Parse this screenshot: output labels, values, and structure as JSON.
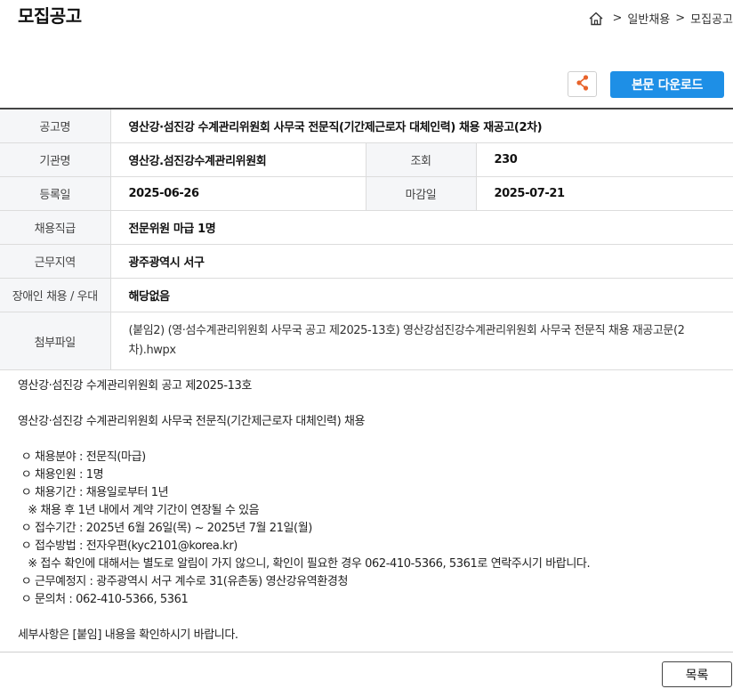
{
  "header": {
    "title": "모집공고",
    "breadcrumb": {
      "sep1": ">",
      "item1": "일반채용",
      "sep2": ">",
      "item2": "모집공고"
    }
  },
  "toolbar": {
    "share_icon": "share-icon",
    "download_label": "본문 다운로드",
    "accent_color": "#1e8fe6"
  },
  "info": {
    "notice_name_label": "공고명",
    "notice_name": "영산강·섬진강 수계관리위원회 사무국 전문직(기간제근로자 대체인력) 채용 재공고(2차)",
    "org_label": "기관명",
    "org": "영산강.섬진강수계관리위원회",
    "views_label": "조회",
    "views": "230",
    "reg_label": "등록일",
    "reg_date": "2025-06-26",
    "deadline_label": "마감일",
    "deadline": "2025-07-21",
    "position_label": "채용직급",
    "position": "전문위원 마급 1명",
    "region_label": "근무지역",
    "region": "광주광역시 서구",
    "disability_label": "장애인 채용 / 우대",
    "disability": "해당없음",
    "attachment_label": "첨부파일",
    "attachment": "(붙임2) (영·섬수계관리위원회 사무국 공고 제2025-13호) 영산강섬진강수계관리위원회 사무국 전문직 채용 재공고문(2차).hwpx"
  },
  "body": {
    "line1": "영산강·섬진강 수계관리위원회 공고 제2025-13호",
    "line2": "",
    "line3": "영산강·섬진강 수계관리위원회 사무국 전문직(기간제근로자 대체인력) 채용",
    "line4": "",
    "line5": " ㅇ 채용분야 : 전문직(마급)",
    "line6": " ㅇ 채용인원 : 1명",
    "line7": " ㅇ 채용기간 : 채용일로부터 1년",
    "line8": "   ※ 채용 후 1년 내에서 계약 기간이 연장될 수 있음",
    "line9": " ㅇ 접수기간 : 2025년 6월 26일(목) ~ 2025년 7월 21일(월)",
    "line10": " ㅇ 접수방법 : 전자우편(kyc2101@korea.kr)",
    "line11": "   ※ 접수 확인에 대해서는 별도로 알림이 가지 않으니, 확인이 필요한 경우 062-410-5366, 5361로 연락주시기 바랍니다.",
    "line12": " ㅇ 근무예정지 : 광주광역시 서구 계수로 31(유촌동) 영산강유역환경청",
    "line13": " ㅇ 문의처 : 062-410-5366, 5361",
    "line14": "",
    "line15": "세부사항은 [붙임] 내용을 확인하시기 바랍니다."
  },
  "footer": {
    "list_label": "목록"
  }
}
